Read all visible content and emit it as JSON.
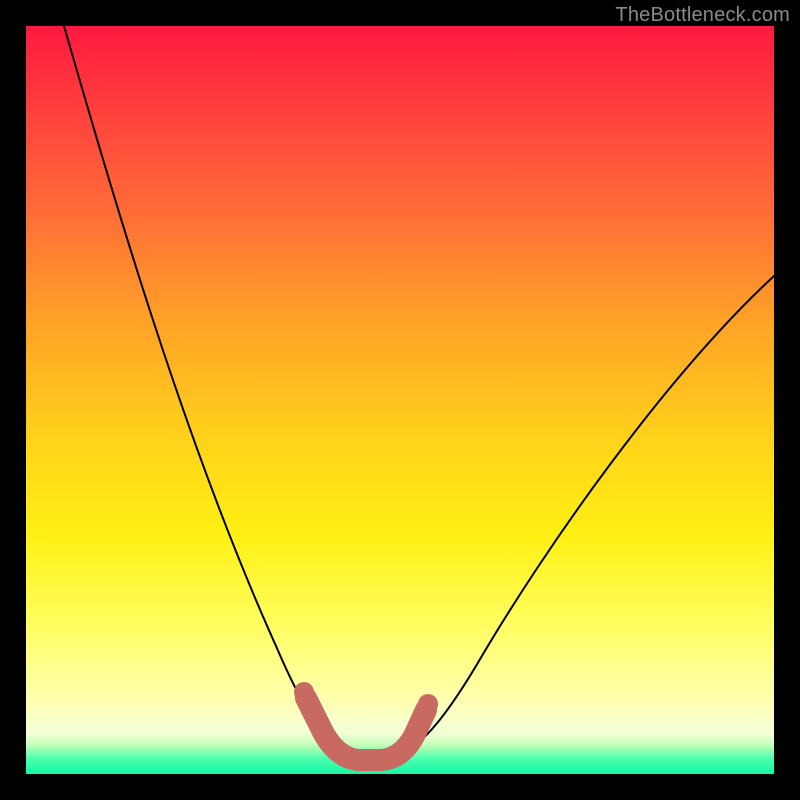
{
  "watermark": {
    "text": "TheBottleneck.com"
  },
  "chart_data": {
    "type": "line",
    "title": "",
    "xlabel": "",
    "ylabel": "",
    "xlim": [
      0,
      100
    ],
    "ylim": [
      0,
      100
    ],
    "grid": false,
    "legend": false,
    "series": [
      {
        "name": "bottleneck-curve",
        "x": [
          5,
          10,
          15,
          20,
          25,
          30,
          35,
          38,
          40,
          42,
          44,
          46,
          48,
          50,
          55,
          60,
          65,
          70,
          75,
          80,
          85,
          90,
          95,
          100
        ],
        "y": [
          100,
          86,
          72,
          58,
          45,
          32,
          20,
          12,
          8,
          5,
          3,
          2.5,
          2.5,
          3,
          6,
          11,
          17,
          23,
          30,
          37,
          44,
          51,
          58,
          65
        ]
      }
    ],
    "annotations": [
      {
        "name": "optimal-zone-marker",
        "shape": "u-marker",
        "x_range": [
          38,
          50
        ],
        "y_range": [
          2,
          12
        ],
        "color": "#c96a62"
      }
    ],
    "background": {
      "type": "vertical-gradient",
      "stops": [
        {
          "pos": 0.0,
          "color": "#ff193f"
        },
        {
          "pos": 0.55,
          "color": "#ffd21a"
        },
        {
          "pos": 0.9,
          "color": "#ffffb0"
        },
        {
          "pos": 1.0,
          "color": "#18f5a2"
        }
      ]
    }
  }
}
